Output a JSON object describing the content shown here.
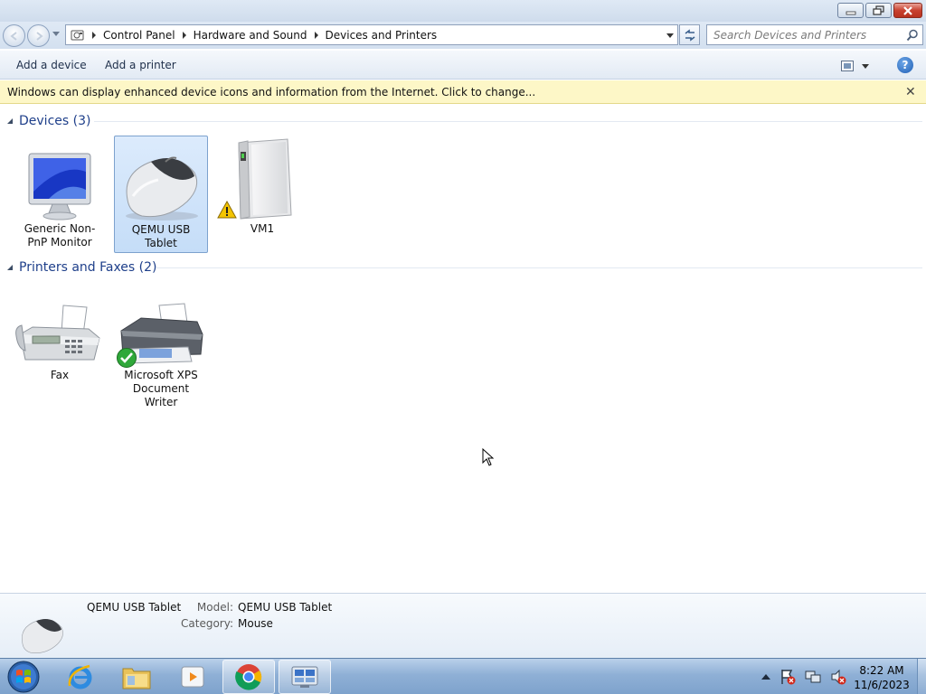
{
  "window": {
    "minimize_label": "Minimize",
    "maximize_label": "Restore",
    "close_label": "Close"
  },
  "address": {
    "crumbs": [
      "Control Panel",
      "Hardware and Sound",
      "Devices and Printers"
    ]
  },
  "search": {
    "placeholder": "Search Devices and Printers"
  },
  "toolbar": {
    "add_device": "Add a device",
    "add_printer": "Add a printer"
  },
  "infobar": {
    "text": "Windows can display enhanced device icons and information from the Internet. Click to change..."
  },
  "groups": {
    "devices": {
      "title": "Devices (3)",
      "items": [
        {
          "label": "Generic Non-PnP Monitor",
          "icon": "monitor-icon"
        },
        {
          "label": "QEMU USB Tablet",
          "icon": "mouse-icon",
          "selected": true
        },
        {
          "label": "VM1",
          "icon": "computer-tower-icon",
          "status": "warning"
        }
      ]
    },
    "printers": {
      "title": "Printers and Faxes (2)",
      "items": [
        {
          "label": "Fax",
          "icon": "fax-icon"
        },
        {
          "label": "Microsoft XPS Document Writer",
          "icon": "printer-icon",
          "status": "default"
        }
      ]
    }
  },
  "details": {
    "name": "QEMU USB Tablet",
    "model_label": "Model:",
    "model_value": "QEMU USB Tablet",
    "category_label": "Category:",
    "category_value": "Mouse"
  },
  "taskbar": {
    "apps": [
      "internet-explorer-icon",
      "windows-explorer-icon",
      "media-player-icon",
      "chrome-icon",
      "devices-and-printers-icon"
    ],
    "time": "8:22 AM",
    "date": "11/6/2023"
  },
  "colors": {
    "group_title": "#1e3f8a",
    "infobar": "#fdf7c7",
    "selected_tile": "#c5ddf8"
  }
}
